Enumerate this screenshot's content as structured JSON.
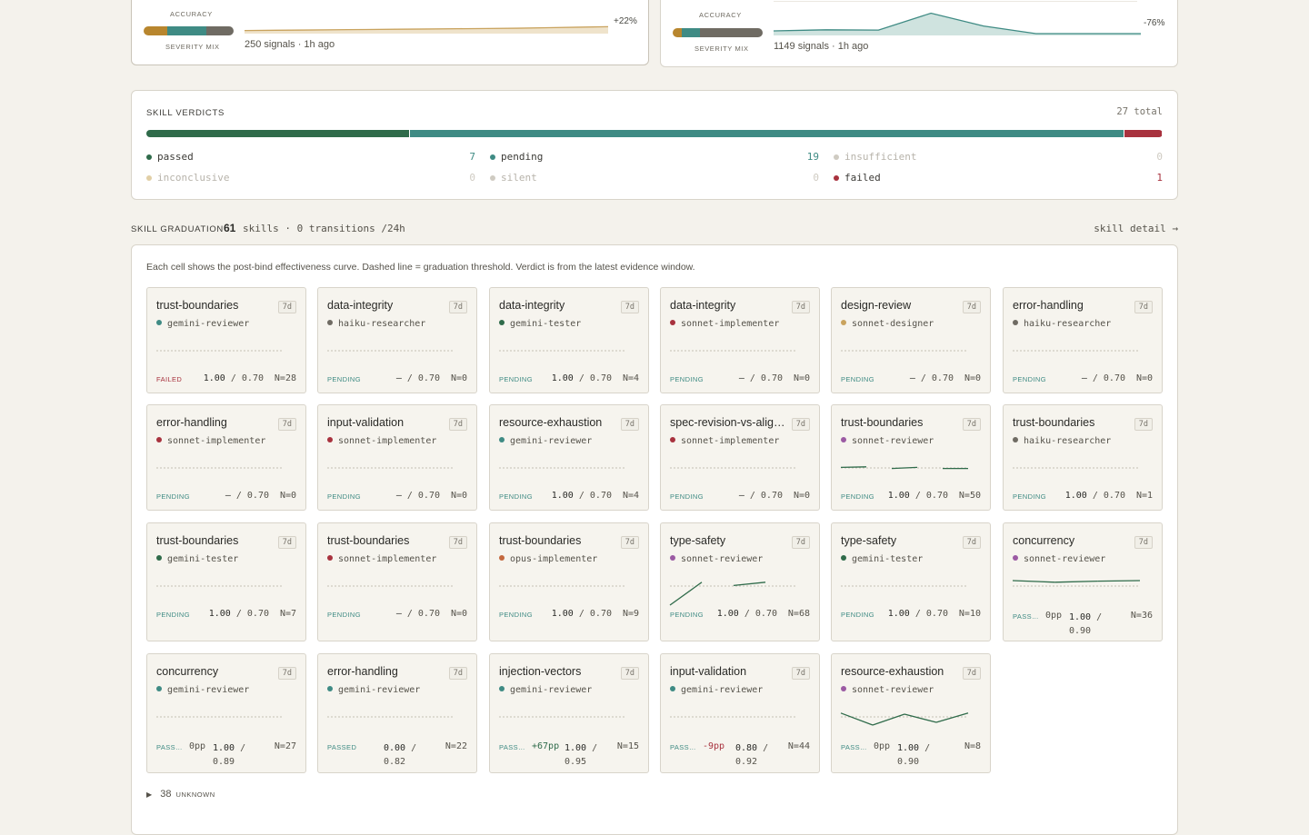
{
  "top_cards": [
    {
      "accuracy_label": "ACCURACY",
      "severity_label": "SEVERITY MIX",
      "delta": "+22%",
      "signals": "250 signals · 1h ago",
      "severity_mix": [
        {
          "color": "#b8862e",
          "fraction": 0.26
        },
        {
          "color": "#3f8b84",
          "fraction": 0.44
        },
        {
          "color": "#6f6b63",
          "fraction": 0.3
        }
      ],
      "spark": {
        "color": "#c9a35e",
        "fill": "#efe3cb",
        "values": [
          0.05,
          0.06,
          0.07,
          0.08,
          0.09,
          0.1,
          0.11,
          0.12,
          0.13,
          0.14,
          0.16,
          0.18,
          0.2
        ]
      }
    },
    {
      "accuracy_label": "ACCURACY",
      "severity_label": "SEVERITY MIX",
      "delta": "-76%",
      "signals": "1149 signals · 1h ago",
      "severity_mix": [
        {
          "color": "#b8862e",
          "fraction": 0.1
        },
        {
          "color": "#3f8b84",
          "fraction": 0.2
        },
        {
          "color": "#6f6b63",
          "fraction": 0.7
        }
      ],
      "spark": {
        "color": "#3f8b84",
        "fill": "#cfe3df",
        "values": [
          0.1,
          0.14,
          0.13,
          0.75,
          0.28,
          0.0,
          0.0,
          0.0
        ]
      }
    }
  ],
  "verdicts": {
    "title": "SKILL VERDICTS",
    "total": "27 total",
    "segments": [
      {
        "color": "#2f6b4a",
        "fraction": 0.259
      },
      {
        "color": "#3f8b84",
        "fraction": 0.704
      },
      {
        "color": "#a8323e",
        "fraction": 0.037
      }
    ],
    "items": [
      {
        "label": "passed",
        "count": "7",
        "dot": "#2f6b4a",
        "color": "#3b3a36",
        "count_color": "#3f8b84"
      },
      {
        "label": "pending",
        "count": "19",
        "dot": "#3f8b84",
        "color": "#3b3a36",
        "count_color": "#3f8b84"
      },
      {
        "label": "insufficient",
        "count": "0",
        "dot": "#cfcbc2",
        "color": "#b7b3aa",
        "count_color": "#cfcbc2"
      },
      {
        "label": "inconclusive",
        "count": "0",
        "dot": "#e1cfa6",
        "color": "#b7b3aa",
        "count_color": "#cfcbc2"
      },
      {
        "label": "silent",
        "count": "0",
        "dot": "#cfcbc2",
        "color": "#b7b3aa",
        "count_color": "#cfcbc2"
      },
      {
        "label": "failed",
        "count": "1",
        "dot": "#a8323e",
        "color": "#3b3a36",
        "count_color": "#a8323e"
      }
    ]
  },
  "graduation": {
    "title": "SKILL GRADUATION",
    "count": "61",
    "summary": "skills · 0 transitions /24h",
    "detail_link": "skill detail →",
    "description": "Each cell shows the post-bind effectiveness curve. Dashed line = graduation threshold. Verdict is from the latest evidence window.",
    "unknown_count": "38",
    "unknown_label": "UNKNOWN",
    "toggle_icon": "▶"
  },
  "tiles": [
    {
      "skill": "trust-boundaries",
      "window": "7d",
      "agent": "gemini-reviewer",
      "agent_color": "#3f8b84",
      "status": "FAILED",
      "status_color": "#a8323e",
      "delta": "",
      "value": "1.00",
      "threshold": "0.70",
      "n": "N=28",
      "curve": []
    },
    {
      "skill": "data-integrity",
      "window": "7d",
      "agent": "haiku-researcher",
      "agent_color": "#6f6b63",
      "status": "PENDING",
      "status_color": "#3f8b84",
      "delta": "",
      "value": "–",
      "threshold": "0.70",
      "n": "N=0",
      "curve": []
    },
    {
      "skill": "data-integrity",
      "window": "7d",
      "agent": "gemini-tester",
      "agent_color": "#2f6b4a",
      "status": "PENDING",
      "status_color": "#3f8b84",
      "delta": "",
      "value": "1.00",
      "threshold": "0.70",
      "n": "N=4",
      "curve": []
    },
    {
      "skill": "data-integrity",
      "window": "7d",
      "agent": "sonnet-implementer",
      "agent_color": "#a8323e",
      "status": "PENDING",
      "status_color": "#3f8b84",
      "delta": "",
      "value": "–",
      "threshold": "0.70",
      "n": "N=0",
      "curve": []
    },
    {
      "skill": "design-review",
      "window": "7d",
      "agent": "sonnet-designer",
      "agent_color": "#c9a35e",
      "status": "PENDING",
      "status_color": "#3f8b84",
      "delta": "",
      "value": "–",
      "threshold": "0.70",
      "n": "N=0",
      "curve": []
    },
    {
      "skill": "error-handling",
      "window": "7d",
      "agent": "haiku-researcher",
      "agent_color": "#6f6b63",
      "status": "PENDING",
      "status_color": "#3f8b84",
      "delta": "",
      "value": "–",
      "threshold": "0.70",
      "n": "N=0",
      "curve": []
    },
    {
      "skill": "error-handling",
      "window": "7d",
      "agent": "sonnet-implementer",
      "agent_color": "#a8323e",
      "status": "PENDING",
      "status_color": "#3f8b84",
      "delta": "",
      "value": "–",
      "threshold": "0.70",
      "n": "N=0",
      "curve": []
    },
    {
      "skill": "input-validation",
      "window": "7d",
      "agent": "sonnet-implementer",
      "agent_color": "#a8323e",
      "status": "PENDING",
      "status_color": "#3f8b84",
      "delta": "",
      "value": "–",
      "threshold": "0.70",
      "n": "N=0",
      "curve": []
    },
    {
      "skill": "resource-exhaustion",
      "window": "7d",
      "agent": "gemini-reviewer",
      "agent_color": "#3f8b84",
      "status": "PENDING",
      "status_color": "#3f8b84",
      "delta": "",
      "value": "1.00",
      "threshold": "0.70",
      "n": "N=4",
      "curve": []
    },
    {
      "skill": "spec-revision-vs-alignment",
      "window": "7d",
      "agent": "sonnet-implementer",
      "agent_color": "#a8323e",
      "status": "PENDING",
      "status_color": "#3f8b84",
      "delta": "",
      "value": "–",
      "threshold": "0.70",
      "n": "N=0",
      "curve": []
    },
    {
      "skill": "trust-boundaries",
      "window": "7d",
      "agent": "sonnet-reviewer",
      "agent_color": "#9b5aa3",
      "status": "PENDING",
      "status_color": "#3f8b84",
      "delta": "",
      "value": "1.00",
      "threshold": "0.70",
      "n": "N=50",
      "curve": [
        [
          0.7,
          0.86
        ],
        [
          1.0,
          0.87
        ],
        [
          1.0,
          0.84
        ],
        [
          0.9,
          0.86
        ],
        [
          1.0,
          0.84
        ],
        [
          1.0,
          0.84
        ]
      ]
    },
    {
      "skill": "trust-boundaries",
      "window": "7d",
      "agent": "haiku-researcher",
      "agent_color": "#6f6b63",
      "status": "PENDING",
      "status_color": "#3f8b84",
      "delta": "",
      "value": "1.00",
      "threshold": "0.70",
      "n": "N=1",
      "curve": []
    },
    {
      "skill": "trust-boundaries",
      "window": "7d",
      "agent": "gemini-tester",
      "agent_color": "#2f6b4a",
      "status": "PENDING",
      "status_color": "#3f8b84",
      "delta": "",
      "value": "1.00",
      "threshold": "0.70",
      "n": "N=7",
      "curve": []
    },
    {
      "skill": "trust-boundaries",
      "window": "7d",
      "agent": "sonnet-implementer",
      "agent_color": "#a8323e",
      "status": "PENDING",
      "status_color": "#3f8b84",
      "delta": "",
      "value": "–",
      "threshold": "0.70",
      "n": "N=0",
      "curve": []
    },
    {
      "skill": "trust-boundaries",
      "window": "7d",
      "agent": "opus-implementer",
      "agent_color": "#c4683e",
      "status": "PENDING",
      "status_color": "#3f8b84",
      "delta": "",
      "value": "1.00",
      "threshold": "0.70",
      "n": "N=9",
      "curve": []
    },
    {
      "skill": "type-safety",
      "window": "7d",
      "agent": "sonnet-reviewer",
      "agent_color": "#9b5aa3",
      "status": "PENDING",
      "status_color": "#3f8b84",
      "delta": "",
      "value": "1.00",
      "threshold": "0.70",
      "n": "N=68",
      "curve": [
        [
          0.66,
          0.5
        ],
        [
          0.9,
          0.92
        ],
        [
          0.87,
          0.86
        ],
        [
          0.9,
          0.92
        ],
        [
          0.94,
          0.94
        ]
      ]
    },
    {
      "skill": "type-safety",
      "window": "7d",
      "agent": "gemini-tester",
      "agent_color": "#2f6b4a",
      "status": "PENDING",
      "status_color": "#3f8b84",
      "delta": "",
      "value": "1.00",
      "threshold": "0.70",
      "n": "N=10",
      "curve": []
    },
    {
      "skill": "concurrency",
      "window": "7d",
      "agent": "sonnet-reviewer",
      "agent_color": "#9b5aa3",
      "status": "PASS…",
      "status_color": "#3f8b84",
      "delta": "0pp",
      "value": "1.00",
      "threshold": "0.90",
      "n": "N=36",
      "curve": [
        [
          0.92,
          0.95
        ],
        [
          0.86,
          0.92
        ],
        [
          0.9,
          0.94
        ],
        [
          0.93,
          0.95
        ]
      ]
    },
    {
      "skill": "concurrency",
      "window": "7d",
      "agent": "gemini-reviewer",
      "agent_color": "#3f8b84",
      "status": "PASS…",
      "status_color": "#3f8b84",
      "delta": "0pp",
      "value": "1.00",
      "threshold": "0.89",
      "n": "N=27",
      "curve": []
    },
    {
      "skill": "error-handling",
      "window": "7d",
      "agent": "gemini-reviewer",
      "agent_color": "#3f8b84",
      "status": "PASSED",
      "status_color": "#3f8b84",
      "delta": "",
      "value": "0.00",
      "threshold": "0.82",
      "n": "N=22",
      "curve": []
    },
    {
      "skill": "injection-vectors",
      "window": "7d",
      "agent": "gemini-reviewer",
      "agent_color": "#3f8b84",
      "status": "PASS…",
      "status_color": "#3f8b84",
      "delta": "+67pp",
      "value": "1.00",
      "threshold": "0.95",
      "n": "N=15",
      "curve": []
    },
    {
      "skill": "input-validation",
      "window": "7d",
      "agent": "gemini-reviewer",
      "agent_color": "#3f8b84",
      "status": "PASS…",
      "status_color": "#3f8b84",
      "delta": "-9pp",
      "value": "0.80",
      "threshold": "0.92",
      "n": "N=44",
      "curve": []
    },
    {
      "skill": "resource-exhaustion",
      "window": "7d",
      "agent": "sonnet-reviewer",
      "agent_color": "#9b5aa3",
      "status": "PASS…",
      "status_color": "#3f8b84",
      "delta": "0pp",
      "value": "1.00",
      "threshold": "0.90",
      "n": "N=8",
      "curve": [
        [
          0.92,
          0.92
        ],
        [
          0.6,
          0.7
        ],
        [
          0.95,
          0.9
        ],
        [
          0.75,
          0.75
        ],
        [
          0.95,
          0.92
        ]
      ]
    }
  ]
}
